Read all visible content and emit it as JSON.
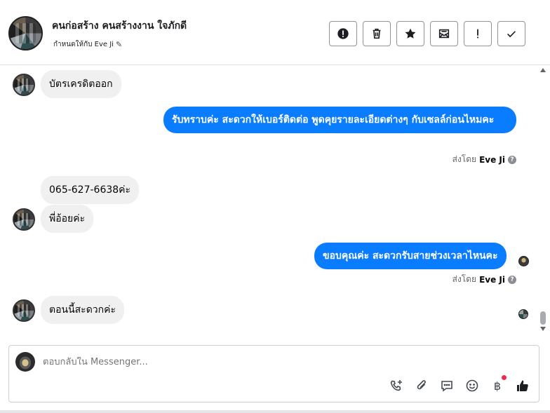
{
  "header": {
    "title": "คนก่อสร้าง คนสร้างงาน ใจภักดี",
    "assign_label": "กำหนดให้กับ Eve Ji",
    "buttons": [
      {
        "name": "mark-spam-button",
        "icon": "exclamation-circle-icon"
      },
      {
        "name": "delete-button",
        "icon": "trash-icon"
      },
      {
        "name": "star-button",
        "icon": "star-icon"
      },
      {
        "name": "mark-unread-button",
        "icon": "envelope-icon"
      },
      {
        "name": "important-button",
        "icon": "exclamation-icon"
      },
      {
        "name": "mark-done-button",
        "icon": "checkmark-icon"
      }
    ]
  },
  "messages": {
    "m1": "บัตรเครดิตออก",
    "m2": "รับทราบค่ะ สะดวกให้เบอร์ติดต่อ พูดคุยรายละเอียดต่างๆ กับเซลล์ก่อนไหมคะ",
    "m3": "065-627-6638ค่ะ",
    "m4": "พี่อ้อยค่ะ",
    "m5": "ขอบคุณค่ะ สะดวกรับสายช่วงเวลาไหนคะ",
    "m6": "ตอนนี้สะดวกค่ะ"
  },
  "sent_by": {
    "prefix": "ส่งโดย",
    "name": "Eve Ji"
  },
  "composer": {
    "placeholder": "ตอบกลับใน Messenger..."
  },
  "colors": {
    "outgoing_bubble": "#0a7cff",
    "incoming_bubble": "#f0f0f0",
    "notification_dot": "#f02849"
  }
}
